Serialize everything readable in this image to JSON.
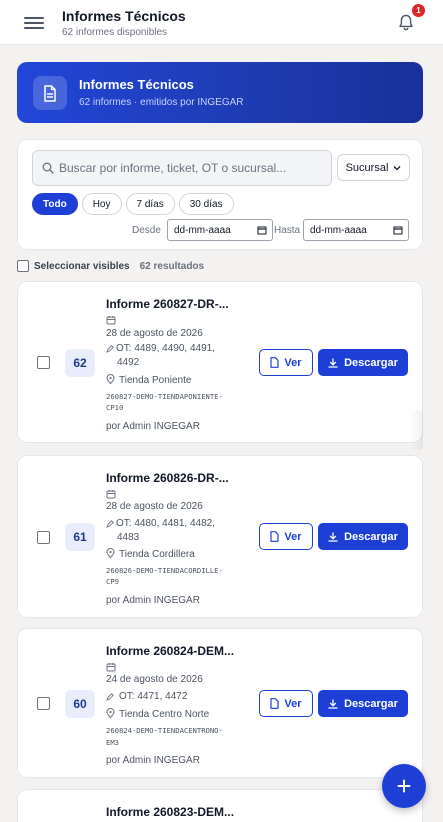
{
  "header": {
    "title": "Informes Técnicos",
    "subtitle": "62 informes disponibles",
    "notification_count": "1",
    "icons": [
      "menu-icon",
      "bell-icon"
    ]
  },
  "banner": {
    "title": "Informes Técnicos",
    "subtitle": "62 informes · emitidos por INGEGAR",
    "icon": "document-icon"
  },
  "filters": {
    "search_placeholder": "Buscar por informe, ticket, OT o sucursal...",
    "sucursal_label": "Sucursal",
    "chips": [
      "Todo",
      "Hoy",
      "7 días",
      "30 días"
    ],
    "active_chip": "Todo",
    "desde_label": "Desde",
    "hasta_label": "Hasta",
    "desde_value": "dd-mm-aaaa",
    "hasta_value": "dd-mm-aaaa"
  },
  "selection": {
    "select_label": "Seleccionar visibles",
    "results": "62 resultados"
  },
  "actions": {
    "ver_label": "Ver",
    "download_label": "Descargar"
  },
  "reports": [
    {
      "number": "62",
      "title": "Informe 260827-DR-...",
      "date": "28 de agosto de 2026",
      "ot_line1": "OT: 4489, 4490, 4491,",
      "ot_line2": "4492",
      "branch": "Tienda Poniente",
      "code_line1": "260827-DEMO-TIENDAPONIENTE-",
      "code_line2": "CP10",
      "author": "por Admin INGEGAR"
    },
    {
      "number": "61",
      "title": "Informe 260826-DR-...",
      "date": "28 de agosto de 2026",
      "ot_line1": "OT: 4480, 4481, 4482,",
      "ot_line2": "4483",
      "branch": "Tienda Cordillera",
      "code_line1": "260826-DEMO-TIENDACORDILLE-",
      "code_line2": "CP9",
      "author": "por Admin INGEGAR"
    },
    {
      "number": "60",
      "title": "Informe 260824-DEM...",
      "date": "24 de agosto de 2026",
      "ot_line1": "OT: 4471, 4472",
      "branch": "Tienda Centro Norte",
      "code_line1": "260824-DEMO-TIENDACENTRONO-",
      "code_line2": "EM3",
      "author": "por Admin INGEGAR"
    },
    {
      "title": "Informe 260823-DEM..."
    }
  ]
}
